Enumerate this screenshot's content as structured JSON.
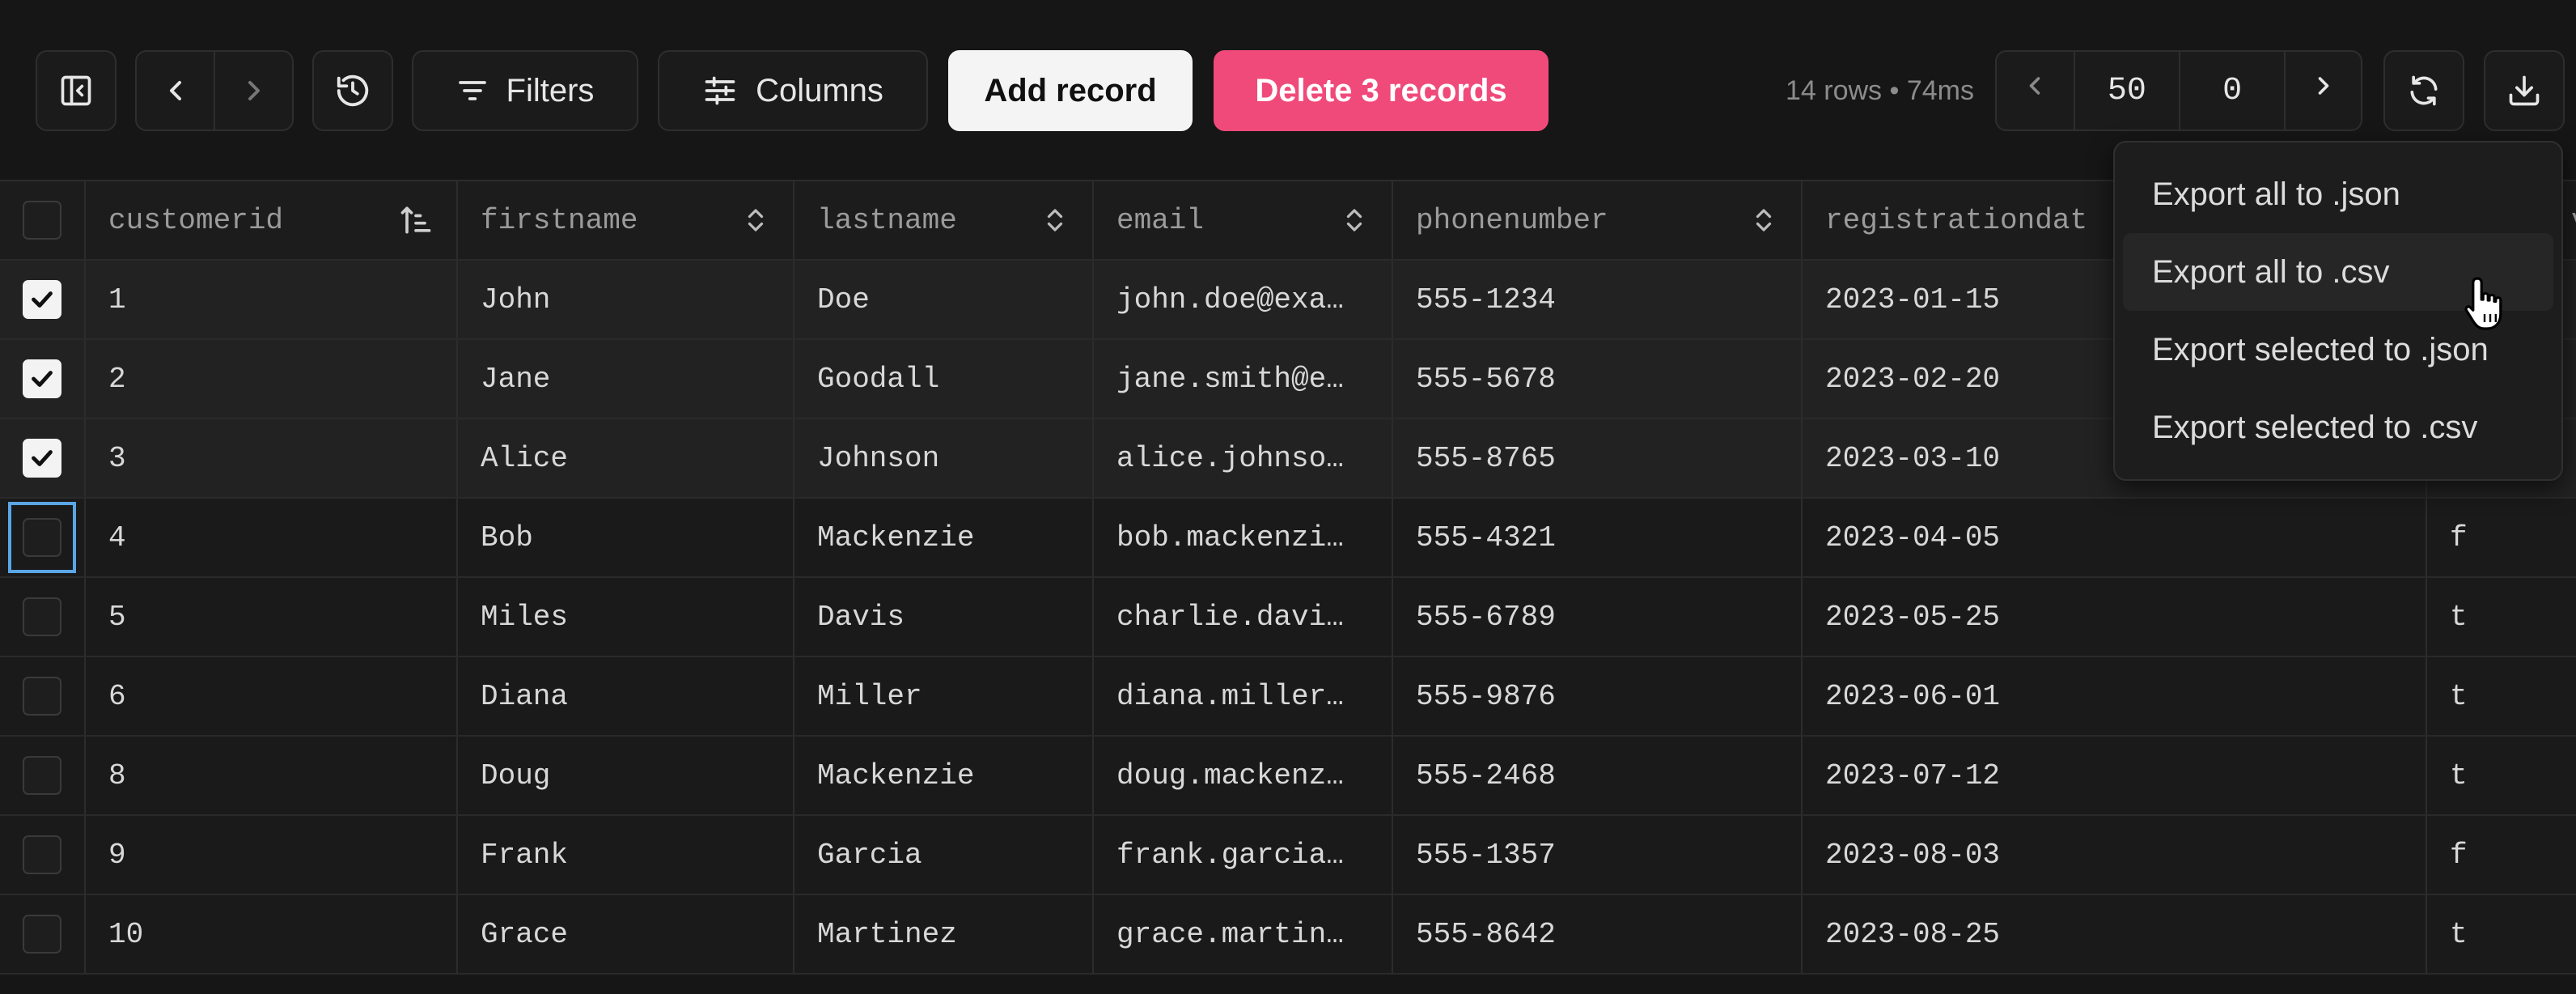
{
  "toolbar": {
    "filters_label": "Filters",
    "columns_label": "Columns",
    "add_label": "Add record",
    "delete_label": "Delete 3 records",
    "rows_info": "14 rows • 74ms",
    "limit": "50",
    "offset": "0"
  },
  "table": {
    "columns": [
      "customerid",
      "firstname",
      "lastname",
      "email",
      "phonenumber",
      "registrationdat",
      "v"
    ],
    "rows": [
      {
        "checked": true,
        "cells": [
          "1",
          "John",
          "Doe",
          "john.doe@exa…",
          "555-1234",
          "2023-01-15",
          ""
        ]
      },
      {
        "checked": true,
        "cells": [
          "2",
          "Jane",
          "Goodall",
          "jane.smith@e…",
          "555-5678",
          "2023-02-20",
          ""
        ]
      },
      {
        "checked": true,
        "cells": [
          "3",
          "Alice",
          "Johnson",
          "alice.johnso…",
          "555-8765",
          "2023-03-10",
          ""
        ]
      },
      {
        "checked": false,
        "focused": true,
        "cells": [
          "4",
          "Bob",
          "Mackenzie",
          "bob.mackenzi…",
          "555-4321",
          "2023-04-05",
          "f"
        ]
      },
      {
        "checked": false,
        "cells": [
          "5",
          "Miles",
          "Davis",
          "charlie.davi…",
          "555-6789",
          "2023-05-25",
          "t"
        ]
      },
      {
        "checked": false,
        "cells": [
          "6",
          "Diana",
          "Miller",
          "diana.miller…",
          "555-9876",
          "2023-06-01",
          "t"
        ]
      },
      {
        "checked": false,
        "cells": [
          "8",
          "Doug",
          "Mackenzie",
          "doug.mackenz…",
          "555-2468",
          "2023-07-12",
          "t"
        ]
      },
      {
        "checked": false,
        "cells": [
          "9",
          "Frank",
          "Garcia",
          "frank.garcia…",
          "555-1357",
          "2023-08-03",
          "f"
        ]
      },
      {
        "checked": false,
        "cells": [
          "10",
          "Grace",
          "Martinez",
          "grace.martin…",
          "555-8642",
          "2023-08-25",
          "t"
        ]
      }
    ]
  },
  "export_menu": {
    "items": [
      {
        "label": "Export all to .json"
      },
      {
        "label": "Export all to .csv"
      },
      {
        "label": "Export selected to .json"
      },
      {
        "label": "Export selected to .csv"
      }
    ]
  },
  "colors": {
    "accent_delete": "#f04a7a",
    "focus": "#5aa6e6",
    "background": "#161616"
  },
  "icons": {
    "sidebar": "sidebar-toggle-icon",
    "prev": "chevron-left-icon",
    "next": "chevron-right-icon",
    "history": "history-icon",
    "filters": "filter-lines-icon",
    "columns": "sliders-icon",
    "refresh": "refresh-icon",
    "export": "download-icon",
    "sort_active": "sort-ascending-icon",
    "sort": "sort-toggle-icon",
    "cursor": "hand-pointer-icon"
  }
}
